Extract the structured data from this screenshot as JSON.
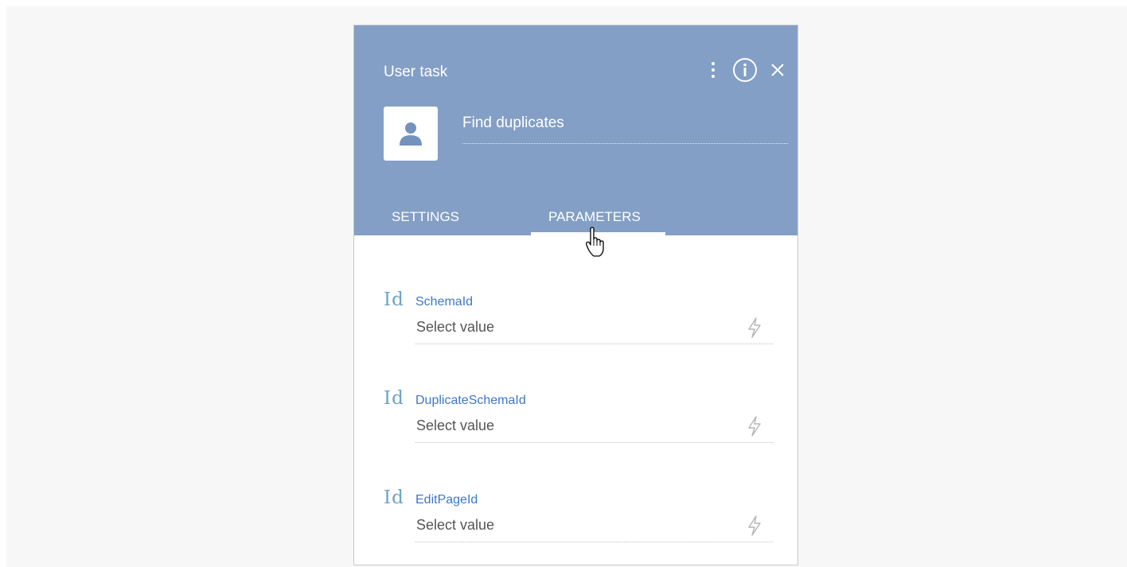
{
  "panel": {
    "title": "User task",
    "task_name": "Find duplicates",
    "colors": {
      "header": "#839fc5",
      "parameter_name": "#3c78c8",
      "type_icon": "#6aa3c9"
    }
  },
  "header_actions": {
    "menu_icon": "vertical-dots-icon",
    "info_icon": "info-icon",
    "close_icon": "close-icon"
  },
  "tabs": [
    {
      "label": "SETTINGS",
      "active": false
    },
    {
      "label": "PARAMETERS",
      "active": true
    }
  ],
  "parameters": [
    {
      "type": "Id",
      "name": "SchemaId",
      "placeholder": "Select value"
    },
    {
      "type": "Id",
      "name": "DuplicateSchemaId",
      "placeholder": "Select value"
    },
    {
      "type": "Id",
      "name": "EditPageId",
      "placeholder": "Select value"
    }
  ]
}
